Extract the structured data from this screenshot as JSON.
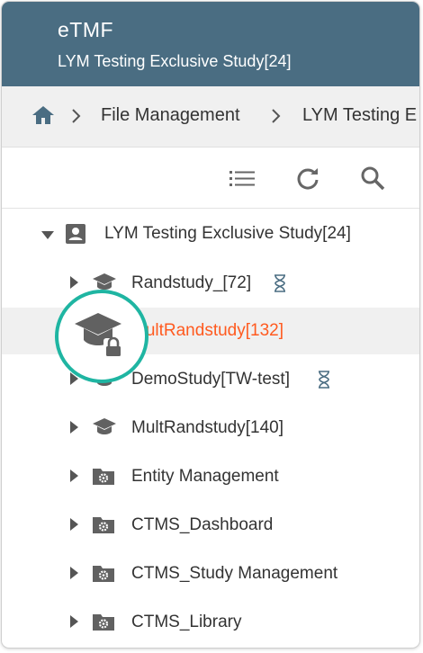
{
  "header": {
    "app_title": "eTMF",
    "study_title": "LYM Testing Exclusive Study[24]"
  },
  "breadcrumb": {
    "items": [
      "File Management",
      "LYM Testing E"
    ]
  },
  "toolbar": {
    "icons": [
      "list-icon",
      "refresh-icon",
      "search-icon"
    ]
  },
  "tree": {
    "root": {
      "label": "LYM Testing Exclusive Study[24]",
      "icon": "account-box-icon",
      "expanded": true
    },
    "children": [
      {
        "label": "Randstudy_[72]",
        "icon": "graduation-cap-icon",
        "status": "hourglass-icon"
      },
      {
        "label": "MultRandstudy[132]",
        "icon": "graduation-cap-lock-icon",
        "selected": true
      },
      {
        "label": "DemoStudy[TW-test]",
        "icon": "graduation-cap-icon",
        "status": "hourglass-icon"
      },
      {
        "label": "MultRandstudy[140]",
        "icon": "graduation-cap-icon"
      },
      {
        "label": "Entity Management",
        "icon": "settings-folder-icon"
      },
      {
        "label": "CTMS_Dashboard",
        "icon": "settings-folder-icon"
      },
      {
        "label": "CTMS_Study Management",
        "icon": "settings-folder-icon"
      },
      {
        "label": "CTMS_Library",
        "icon": "settings-folder-icon"
      }
    ]
  },
  "colors": {
    "header_bg": "#4a6d82",
    "selected_text": "#ff5a1f",
    "callout_ring": "#1fb5a2",
    "icon_gray": "#616161"
  }
}
